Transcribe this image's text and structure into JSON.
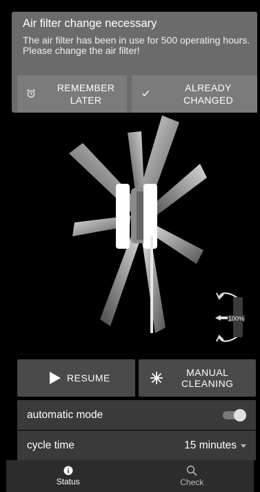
{
  "notification": {
    "title": "Air filter change necessary",
    "body_line1": "The air filter has been in use for 500 operating hours.",
    "body_line2": "Please change the air filter!",
    "remember_label": "REMEMBER\nLATER",
    "remember_icon": "alarm-clock-icon",
    "changed_label": "ALREADY\nCHANGED",
    "changed_icon": "checkmark-icon"
  },
  "fan": {
    "blades": 8,
    "icon": "fan-icon"
  },
  "rotation_indicator": {
    "value": "100%",
    "icon": "rotation-arrows-icon"
  },
  "actions": {
    "resume_label": "RESUME",
    "resume_icon": "play-icon",
    "cleaning_label": "MANUAL\nCLEANING",
    "cleaning_icon": "sparkle-icon"
  },
  "settings": {
    "automatic_mode_label": "automatic mode",
    "automatic_mode_on": true,
    "cycle_time_label": "cycle time",
    "cycle_time_value": "15 minutes"
  },
  "nav": {
    "items": [
      {
        "label": "Status",
        "icon": "info-icon",
        "active": true
      },
      {
        "label": "Check",
        "icon": "search-icon",
        "active": false
      }
    ]
  },
  "colors": {
    "background": "#000000",
    "notification_bg": "#6b6b6b",
    "button_bg": "#4a4a4a",
    "row_bg": "#3a3a3a",
    "nav_bg": "#2c2c2c"
  }
}
